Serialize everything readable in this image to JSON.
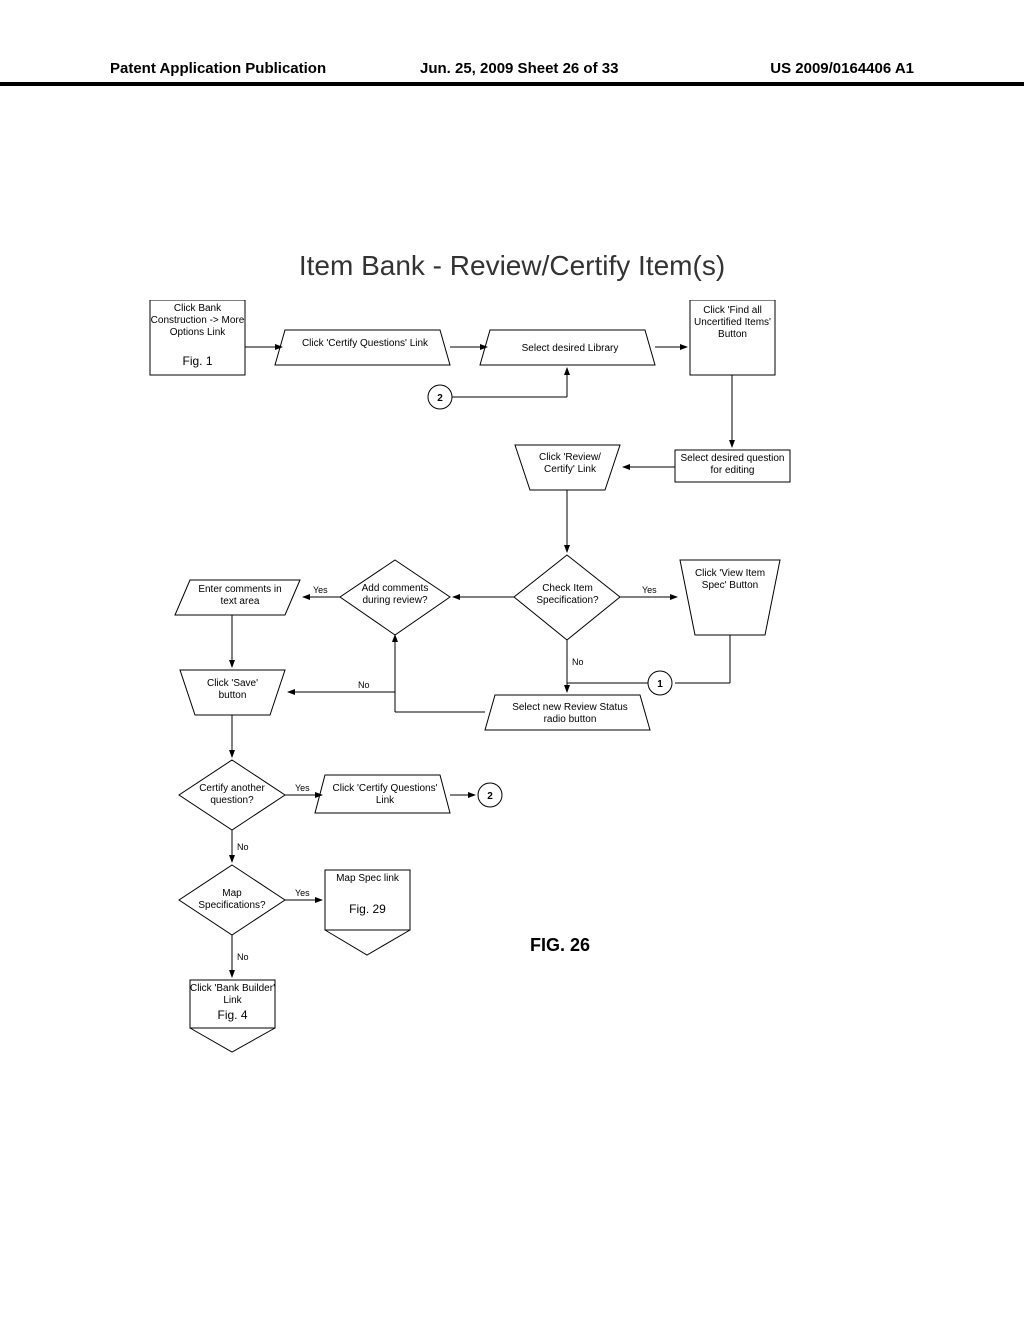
{
  "header": {
    "left": "Patent Application Publication",
    "mid": "Jun. 25, 2009  Sheet 26 of 33",
    "right": "US 2009/0164406 A1"
  },
  "title": "Item Bank - Review/Certify Item(s)",
  "figure_label": "FIG. 26",
  "nodes": {
    "a1": "Click Bank Construction -> More Options Link",
    "a1_ref": "Fig. 1",
    "a2": "Click 'Certify Questions' Link",
    "a3": "Select desired Library",
    "a4": "Click 'Find all Uncertified Items' Button",
    "b4": "Select desired question for editing",
    "b3": "Click 'Review/ Certify' Link",
    "c3": "Check Item Specification?",
    "c4": "Click 'View Item Spec' Button",
    "c2": "Add comments during review?",
    "c1": "Enter comments in text area",
    "d1": "Click 'Save' button",
    "d3": "Select new Review Status radio button",
    "e1": "Certify another question?",
    "e2": "Click 'Certify Questions' Link",
    "f1": "Map Specifications?",
    "f2": "Map Spec link",
    "f2_ref": "Fig. 29",
    "g1": "Click 'Bank Builder' Link",
    "g1_ref": "Fig. 4"
  },
  "edges": {
    "yes": "Yes",
    "no": "No"
  },
  "conn": {
    "c1": "1",
    "c2": "2",
    "c2b": "2"
  }
}
